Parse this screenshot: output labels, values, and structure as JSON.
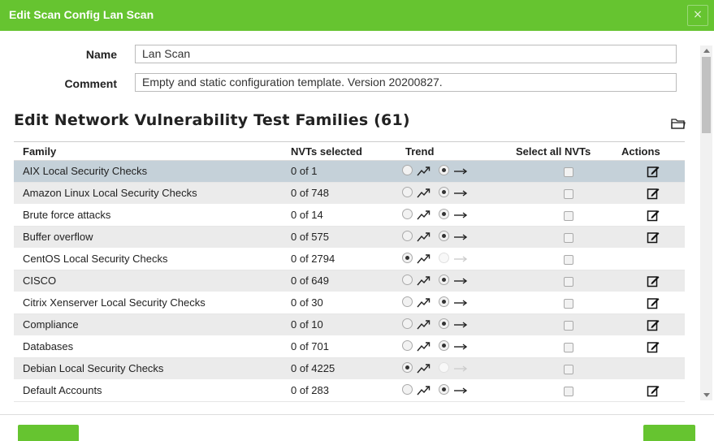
{
  "dialog": {
    "title": "Edit Scan Config Lan Scan",
    "close_label": "×"
  },
  "form": {
    "name_label": "Name",
    "name_value": "Lan Scan",
    "comment_label": "Comment",
    "comment_value": "Empty and static configuration template. Version 20200827."
  },
  "section": {
    "title": "Edit Network Vulnerability Test Families (61)"
  },
  "table": {
    "headers": {
      "family": "Family",
      "nvts_selected": "NVTs selected",
      "trend": "Trend",
      "select_all": "Select all NVTs",
      "actions": "Actions"
    },
    "rows": [
      {
        "family": "AIX Local Security Checks",
        "count": "0 of 1",
        "trend": "static",
        "select_all": false,
        "editable": true,
        "selected": true
      },
      {
        "family": "Amazon Linux Local Security Checks",
        "count": "0 of 748",
        "trend": "static",
        "select_all": false,
        "editable": true
      },
      {
        "family": "Brute force attacks",
        "count": "0 of 14",
        "trend": "static",
        "select_all": false,
        "editable": true
      },
      {
        "family": "Buffer overflow",
        "count": "0 of 575",
        "trend": "static",
        "select_all": false,
        "editable": true
      },
      {
        "family": "CentOS Local Security Checks",
        "count": "0 of 2794",
        "trend": "dynamic_locked",
        "select_all": false,
        "editable": false
      },
      {
        "family": "CISCO",
        "count": "0 of 649",
        "trend": "static",
        "select_all": false,
        "editable": true
      },
      {
        "family": "Citrix Xenserver Local Security Checks",
        "count": "0 of 30",
        "trend": "static",
        "select_all": false,
        "editable": true
      },
      {
        "family": "Compliance",
        "count": "0 of 10",
        "trend": "static",
        "select_all": false,
        "editable": true
      },
      {
        "family": "Databases",
        "count": "0 of 701",
        "trend": "static",
        "select_all": false,
        "editable": true
      },
      {
        "family": "Debian Local Security Checks",
        "count": "0 of 4225",
        "trend": "dynamic_locked",
        "select_all": false,
        "editable": false
      },
      {
        "family": "Default Accounts",
        "count": "0 of 283",
        "trend": "static",
        "select_all": false,
        "editable": true
      }
    ]
  },
  "icons": {
    "close": "close-icon",
    "folder": "folder-icon",
    "trend_dynamic": "trend-dynamic-icon",
    "trend_static": "trend-static-icon",
    "edit": "edit-icon"
  },
  "colors": {
    "accent": "#66c430",
    "selected_row": "#c5d1d9",
    "striped_row": "#ebebeb"
  }
}
